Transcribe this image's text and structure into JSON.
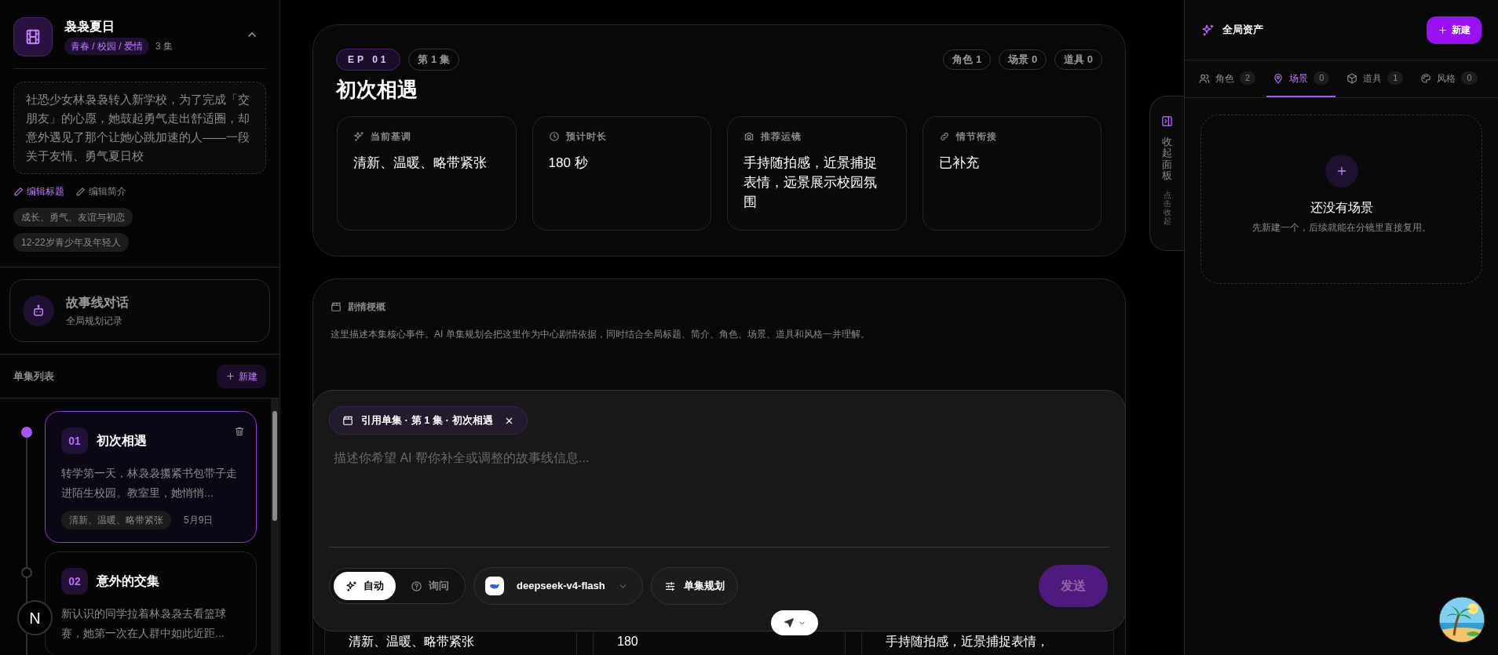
{
  "project": {
    "title": "袅袅夏日",
    "genre_tag": "青春 / 校园 / 爱情",
    "episode_count": "3 集",
    "synopsis": "社恐少女林袅袅转入新学校，为了完成「交朋友」的心愿，她鼓起勇气走出舒适圈，却意外遇见了那个让她心跳加速的人——一段关于友情、勇气夏日校",
    "actions": [
      {
        "label": "编辑标题",
        "selected": true
      },
      {
        "label": "编辑简介",
        "selected": false
      }
    ],
    "tags": [
      "成长、勇气、友谊与初恋",
      "12-22岁青少年及年轻人"
    ]
  },
  "storyline_chat": {
    "title": "故事线对话",
    "subtitle": "全局规划记录"
  },
  "episode_list": {
    "heading": "单集列表",
    "new_button": "新建",
    "episodes": [
      {
        "number": "01",
        "title": "初次相遇",
        "summary": "转学第一天，林袅袅攥紧书包带子走进陌生校园。教室里，她悄悄...",
        "tone": "清新、温暖、略带紧张",
        "date": "5月9日",
        "selected": true
      },
      {
        "number": "02",
        "title": "意外的交集",
        "summary": "新认识的同学拉着林袅袅去看篮球赛，她第一次在人群中如此近距...",
        "selected": false
      }
    ]
  },
  "dev_badge": "N",
  "episode": {
    "ep_code": "EP 01",
    "ep_label": "第 1 集",
    "counts": [
      "角色 1",
      "场景 0",
      "道具 0"
    ],
    "title": "初次相遇",
    "info_cards": [
      {
        "kind": "tone",
        "label": "当前基调",
        "value": "清新、温暖、略带紧张"
      },
      {
        "kind": "duration",
        "label": "预计时长",
        "value": "180 秒"
      },
      {
        "kind": "camera",
        "label": "推荐运镜",
        "value": "手持随拍感，近景捕捉表情，远景展示校园氛围"
      },
      {
        "kind": "link",
        "label": "情节衔接",
        "value": "已补充"
      }
    ]
  },
  "summary": {
    "title": "剧情梗概",
    "description": "这里描述本集核心事件。AI 单集规划会把这里作为中心剧情依据，同时结合全局标题、简介、角色、场景、道具和风格一并理解。",
    "preview_cards": [
      "清新、温暖、略带紧张",
      "180",
      "手持随拍感，近景捕捉表情，"
    ]
  },
  "composer": {
    "reference_chip": "引用单集 · 第 1 集 · 初次相遇",
    "placeholder": "描述你希望 AI 帮你补全或调整的故事线信息...",
    "modes": [
      {
        "kind": "auto",
        "label": "自动",
        "selected": true
      },
      {
        "kind": "ask",
        "label": "询问",
        "selected": false
      }
    ],
    "model": "deepseek-v4-flash",
    "plan_button": "单集规划",
    "send_button": {
      "label": "发送",
      "disabled": true
    }
  },
  "collapse_tab": {
    "label": "收起面板",
    "hint": "点击收起"
  },
  "assets": {
    "title": "全局资产",
    "new_button": "新建",
    "tabs": [
      {
        "kind": "characters",
        "label": "角色",
        "count": "2",
        "selected": false
      },
      {
        "kind": "scenes",
        "label": "场景",
        "count": "0",
        "selected": true
      },
      {
        "kind": "props",
        "label": "道具",
        "count": "1",
        "selected": false
      },
      {
        "kind": "styles",
        "label": "风格",
        "count": "0",
        "selected": false
      }
    ],
    "empty": {
      "title": "还没有场景",
      "subtitle": "先新建一个，后续就能在分镜里直接复用。"
    }
  }
}
